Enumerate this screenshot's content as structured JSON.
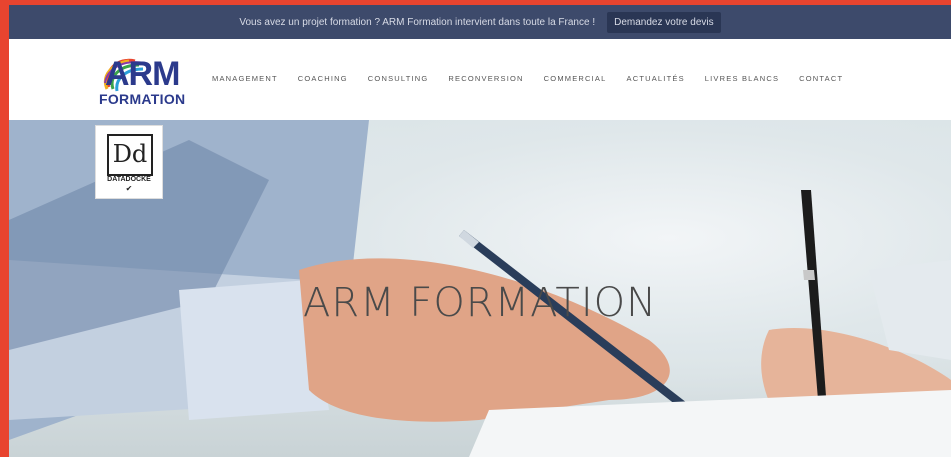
{
  "topbar": {
    "message": "Vous avez un projet formation ? ARM Formation intervient dans toute la France !",
    "cta_label": "Demandez votre devis"
  },
  "logo": {
    "arm": "ARM",
    "formation": "FORMATION"
  },
  "nav": {
    "items": [
      "MANAGEMENT",
      "COACHING",
      "CONSULTING",
      "RECONVERSION",
      "COMMERCIAL",
      "ACTUALITÉS",
      "LIVRES BLANCS",
      "CONTACT"
    ]
  },
  "badge": {
    "mark": "Dd",
    "label": "DATADOCKÉ",
    "check": "✔"
  },
  "hero": {
    "title": "ARM FORMATION"
  },
  "colors": {
    "topbar_bg": "#3d4a6b",
    "brand_blue": "#2b3a8c",
    "outer_frame": "#e8442f"
  }
}
